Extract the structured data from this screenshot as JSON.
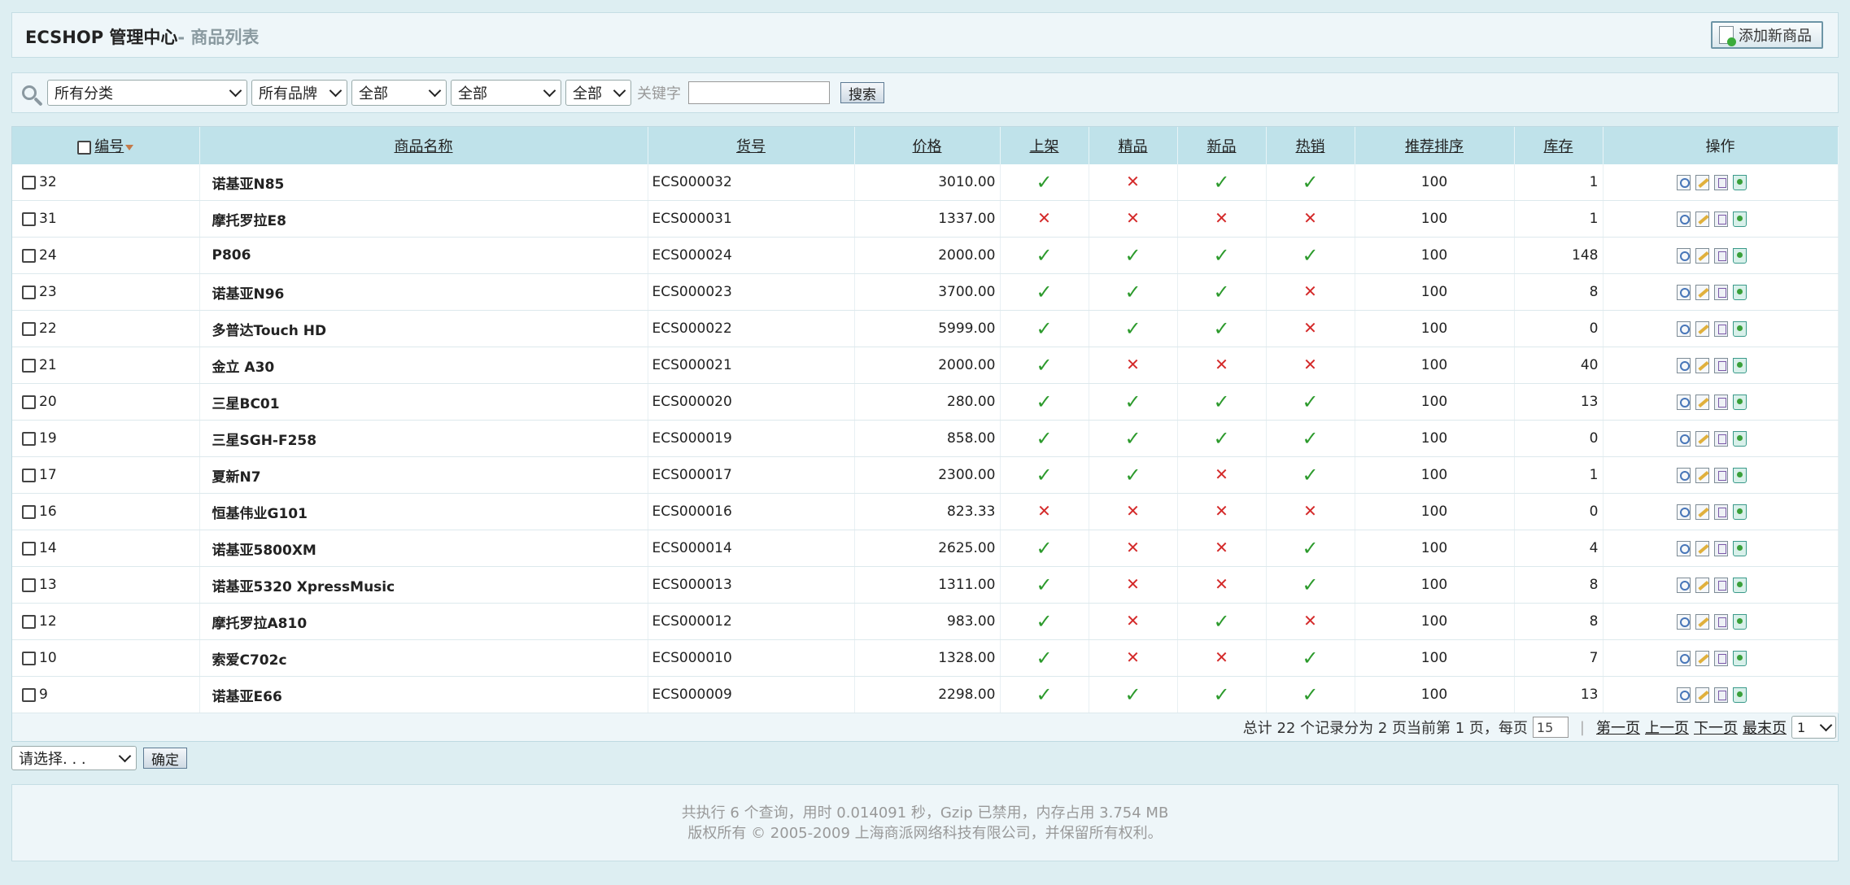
{
  "header": {
    "title": "ECSHOP 管理中心",
    "subtitle": "- 商品列表",
    "add_button": "添加新商品"
  },
  "search": {
    "category": "所有分类",
    "brand": "所有品牌",
    "filter1": "全部",
    "filter2": "全部",
    "filter3": "全部",
    "keyword_label": "关键字",
    "keyword_value": "",
    "search_button": "搜索"
  },
  "table": {
    "columns": {
      "id": "编号",
      "name": "商品名称",
      "sn": "货号",
      "price": "价格",
      "on_sale": "上架",
      "best": "精品",
      "new": "新品",
      "hot": "热销",
      "sort": "推荐排序",
      "stock": "库存",
      "ops": "操作"
    },
    "rows": [
      {
        "id": "32",
        "name": "诺基亚N85",
        "sn": "ECS000032",
        "price": "3010.00",
        "on_sale": true,
        "best": false,
        "new": true,
        "hot": true,
        "sort": "100",
        "stock": "1"
      },
      {
        "id": "31",
        "name": "摩托罗拉E8",
        "sn": "ECS000031",
        "price": "1337.00",
        "on_sale": false,
        "best": false,
        "new": false,
        "hot": false,
        "sort": "100",
        "stock": "1"
      },
      {
        "id": "24",
        "name": "P806",
        "sn": "ECS000024",
        "price": "2000.00",
        "on_sale": true,
        "best": true,
        "new": true,
        "hot": true,
        "sort": "100",
        "stock": "148"
      },
      {
        "id": "23",
        "name": "诺基亚N96",
        "sn": "ECS000023",
        "price": "3700.00",
        "on_sale": true,
        "best": true,
        "new": true,
        "hot": false,
        "sort": "100",
        "stock": "8"
      },
      {
        "id": "22",
        "name": "多普达Touch HD",
        "sn": "ECS000022",
        "price": "5999.00",
        "on_sale": true,
        "best": true,
        "new": true,
        "hot": false,
        "sort": "100",
        "stock": "0"
      },
      {
        "id": "21",
        "name": "金立 A30",
        "sn": "ECS000021",
        "price": "2000.00",
        "on_sale": true,
        "best": false,
        "new": false,
        "hot": false,
        "sort": "100",
        "stock": "40"
      },
      {
        "id": "20",
        "name": "三星BC01",
        "sn": "ECS000020",
        "price": "280.00",
        "on_sale": true,
        "best": true,
        "new": true,
        "hot": true,
        "sort": "100",
        "stock": "13"
      },
      {
        "id": "19",
        "name": "三星SGH-F258",
        "sn": "ECS000019",
        "price": "858.00",
        "on_sale": true,
        "best": true,
        "new": true,
        "hot": true,
        "sort": "100",
        "stock": "0"
      },
      {
        "id": "17",
        "name": "夏新N7",
        "sn": "ECS000017",
        "price": "2300.00",
        "on_sale": true,
        "best": true,
        "new": false,
        "hot": true,
        "sort": "100",
        "stock": "1"
      },
      {
        "id": "16",
        "name": "恒基伟业G101",
        "sn": "ECS000016",
        "price": "823.33",
        "on_sale": false,
        "best": false,
        "new": false,
        "hot": false,
        "sort": "100",
        "stock": "0"
      },
      {
        "id": "14",
        "name": "诺基亚5800XM",
        "sn": "ECS000014",
        "price": "2625.00",
        "on_sale": true,
        "best": false,
        "new": false,
        "hot": true,
        "sort": "100",
        "stock": "4"
      },
      {
        "id": "13",
        "name": "诺基亚5320 XpressMusic",
        "sn": "ECS000013",
        "price": "1311.00",
        "on_sale": true,
        "best": false,
        "new": false,
        "hot": true,
        "sort": "100",
        "stock": "8"
      },
      {
        "id": "12",
        "name": "摩托罗拉A810",
        "sn": "ECS000012",
        "price": "983.00",
        "on_sale": true,
        "best": false,
        "new": true,
        "hot": false,
        "sort": "100",
        "stock": "8"
      },
      {
        "id": "10",
        "name": "索爱C702c",
        "sn": "ECS000010",
        "price": "1328.00",
        "on_sale": true,
        "best": false,
        "new": false,
        "hot": true,
        "sort": "100",
        "stock": "7"
      },
      {
        "id": "9",
        "name": "诺基亚E66",
        "sn": "ECS000009",
        "price": "2298.00",
        "on_sale": true,
        "best": true,
        "new": true,
        "hot": true,
        "sort": "100",
        "stock": "13"
      }
    ]
  },
  "pager": {
    "summary": "总计 22 个记录分为 2 页当前第 1 页，每页",
    "per_page": "15",
    "first": "第一页",
    "prev": "上一页",
    "next": "下一页",
    "last": "最末页",
    "page_select": "1"
  },
  "batch": {
    "select": "请选择. . .",
    "confirm": "确定"
  },
  "footer": {
    "line1": "共执行 6 个查询，用时 0.014091 秒，Gzip 已禁用，内存占用 3.754 MB",
    "line2": "版权所有 © 2005-2009 上海商派网络科技有限公司，并保留所有权利。"
  },
  "colors": {
    "background": "#ddeef2",
    "table_header": "#bfe2ea",
    "check_ok": "#2c9a2c",
    "check_no": "#d42a2a"
  }
}
